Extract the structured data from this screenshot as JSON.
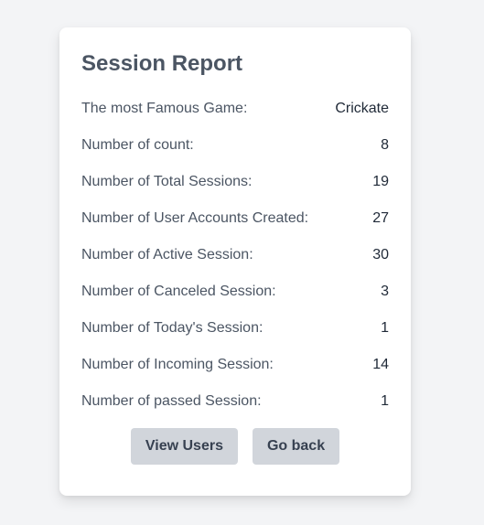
{
  "report": {
    "title": "Session Report",
    "rows": [
      {
        "label": "The most Famous Game:",
        "value": "Crickate"
      },
      {
        "label": "Number of count:",
        "value": "8"
      },
      {
        "label": "Number of Total Sessions:",
        "value": "19"
      },
      {
        "label": "Number of User Accounts Created:",
        "value": "27"
      },
      {
        "label": "Number of Active Session:",
        "value": "30"
      },
      {
        "label": "Number of Canceled Session:",
        "value": "3"
      },
      {
        "label": "Number of Today's Session:",
        "value": "1"
      },
      {
        "label": "Number of Incoming Session:",
        "value": "14"
      },
      {
        "label": "Number of passed Session:",
        "value": "1"
      }
    ]
  },
  "actions": {
    "view_users_label": "View Users",
    "go_back_label": "Go back"
  },
  "colors": {
    "page_background": "#f3f4f6",
    "card_background": "#ffffff",
    "button_background": "#d1d5db",
    "title_text": "#4b5563"
  }
}
